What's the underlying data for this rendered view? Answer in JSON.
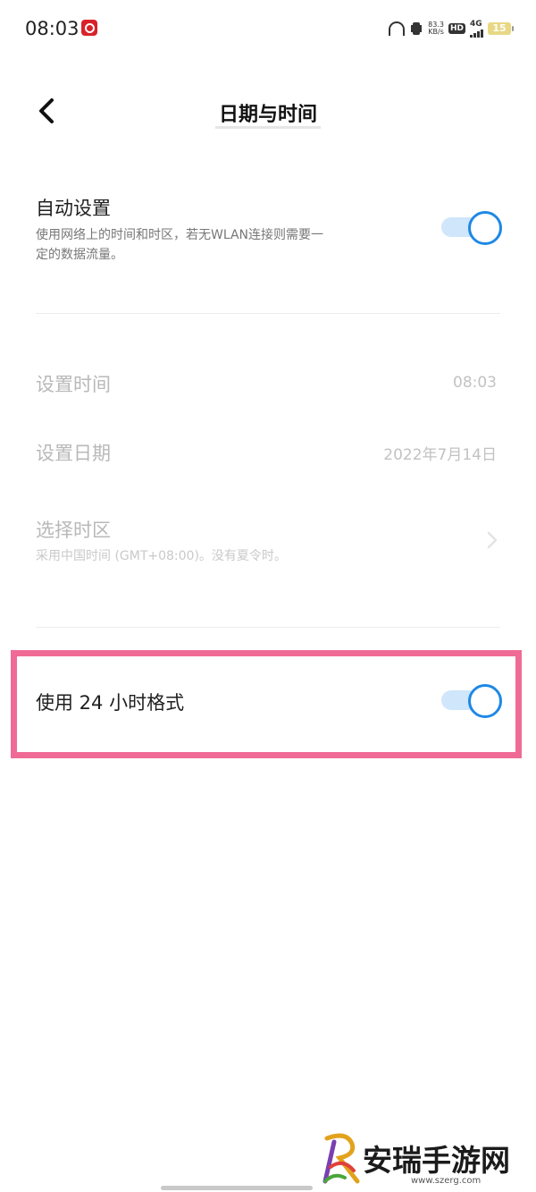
{
  "status_bar": {
    "time": "08:03",
    "net_speed_value": "83.3",
    "net_speed_unit": "KB/s",
    "hd": "HD",
    "network": "4G",
    "battery": "15",
    "icons": [
      "netease-music-icon",
      "headphone-icon",
      "vibrate-icon",
      "signal-icon",
      "battery-icon"
    ]
  },
  "header": {
    "title": "日期与时间",
    "back_icon": "chevron-left-icon"
  },
  "settings": {
    "auto_set": {
      "title": "自动设置",
      "desc_line1": "使用网络上的时间和时区，若无WLAN连接则需要一",
      "desc_line2": "定的数据流量。",
      "enabled": true
    },
    "set_time": {
      "title": "设置时间",
      "value": "08:03"
    },
    "set_date": {
      "title": "设置日期",
      "value": "2022年7月14日"
    },
    "time_zone": {
      "title": "选择时区",
      "desc": "采用中国时间 (GMT+08:00)。没有夏令时。"
    },
    "use_24h": {
      "title": "使用 24 小时格式",
      "enabled": true
    }
  },
  "colors": {
    "accent": "#1e88e5",
    "highlight": "#ef6b96"
  },
  "watermark": {
    "text": "安瑞手游网",
    "url": "www.szerg.com"
  }
}
